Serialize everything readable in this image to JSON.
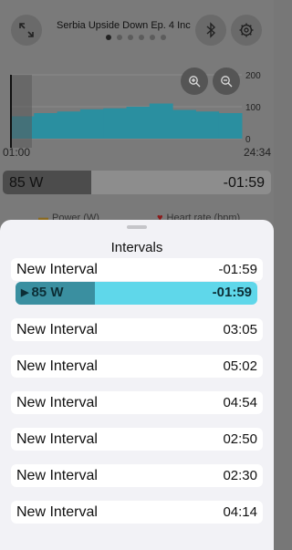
{
  "header": {
    "title": "Serbia Upside Down Ep. 4 Inc",
    "pages": 6,
    "active_page": 0
  },
  "timeline": {
    "start": "01:00",
    "end": "24:34"
  },
  "chart_data": {
    "type": "area",
    "x": [
      0,
      1,
      2,
      3,
      4,
      5,
      6,
      7,
      8,
      9
    ],
    "values": [
      70,
      80,
      85,
      92,
      95,
      100,
      110,
      90,
      85,
      80
    ],
    "yticks": [
      "200",
      "100",
      "0"
    ],
    "ylim": [
      0,
      200
    ]
  },
  "current_interval": {
    "label": "85 W",
    "remaining": "-01:59",
    "progress": 0.33
  },
  "tabs": [
    {
      "label": "Power (W)",
      "icon": "dumbbell-icon"
    },
    {
      "label": "Heart rate (bpm)",
      "icon": "heart-icon"
    }
  ],
  "sheet": {
    "title": "Intervals",
    "active_item": {
      "name": "New Interval",
      "time": "-01:59",
      "step_label": "85 W",
      "step_time": "-01:59",
      "progress": 0.33
    },
    "items": [
      {
        "name": "New Interval",
        "time": "03:05"
      },
      {
        "name": "New Interval",
        "time": "05:02"
      },
      {
        "name": "New Interval",
        "time": "04:54"
      },
      {
        "name": "New Interval",
        "time": "02:50"
      },
      {
        "name": "New Interval",
        "time": "02:30"
      },
      {
        "name": "New Interval",
        "time": "04:14"
      }
    ]
  },
  "colors": {
    "accent": "#5fd7ea",
    "accent_dark": "#3a8fa0",
    "chart_fill": "#2a8fa0"
  }
}
